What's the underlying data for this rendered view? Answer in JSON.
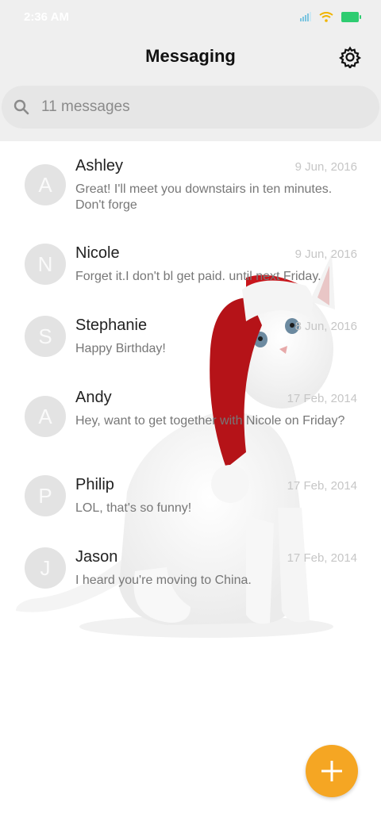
{
  "status": {
    "time": "2:36 AM",
    "battery_color": "#2ecc71"
  },
  "header": {
    "title": "Messaging",
    "settings_icon": "gear-icon"
  },
  "search": {
    "placeholder": "11 messages",
    "icon": "search-icon"
  },
  "conversations": [
    {
      "initial": "A",
      "name": "Ashley",
      "date": "9 Jun, 2016",
      "preview": "Great! I'll meet you downstairs in ten minutes. Don't forge"
    },
    {
      "initial": "N",
      "name": "Nicole",
      "date": "9 Jun, 2016",
      "preview": "Forget it.I don't bl get paid. until next Friday."
    },
    {
      "initial": "S",
      "name": "Stephanie",
      "date": "8 Jun, 2016",
      "preview": "Happy Birthday!"
    },
    {
      "initial": "A",
      "name": "Andy",
      "date": "17 Feb, 2014",
      "preview": "Hey, want to get together with Nicole on Friday?"
    },
    {
      "initial": "P",
      "name": "Philip",
      "date": "17 Feb, 2014",
      "preview": "LOL, that's so funny!"
    },
    {
      "initial": "J",
      "name": "Jason",
      "date": "17 Feb, 2014",
      "preview": "I heard you're moving to China."
    }
  ],
  "fab": {
    "icon": "plus-icon",
    "color": "#f5a623"
  },
  "wallpaper": {
    "subject": "cat-icon"
  }
}
